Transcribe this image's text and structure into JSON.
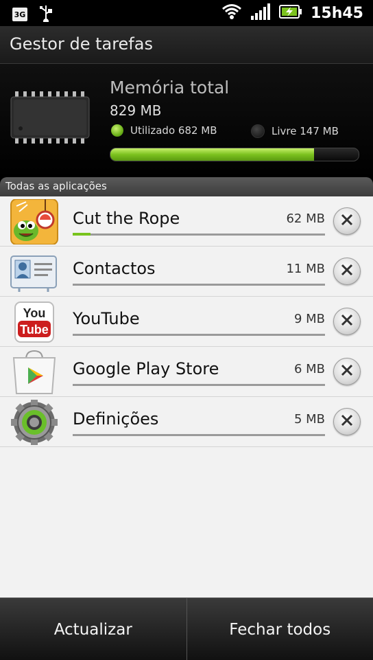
{
  "status_bar": {
    "network_badge": "3G",
    "usb_icon": "usb-icon",
    "wifi_icon": "wifi-icon",
    "signal_icon": "signal-icon",
    "battery_icon": "battery-charging-icon",
    "time": "15h45"
  },
  "header": {
    "title": "Gestor de tarefas"
  },
  "memory": {
    "title": "Memória total",
    "total": "829 MB",
    "used_label": "Utilizado 682 MB",
    "free_label": "Livre 147 MB",
    "used_fraction": 0.82,
    "colors": {
      "used": "#7cc21f",
      "free": "#1a1a1a"
    }
  },
  "section": {
    "title": "Todas as aplicações"
  },
  "apps": [
    {
      "name": "Cut the Rope",
      "size": "62 MB",
      "icon": "cut-the-rope-icon",
      "usage_fraction": 0.07
    },
    {
      "name": "Contactos",
      "size": "11 MB",
      "icon": "contacts-icon",
      "usage_fraction": 0.0
    },
    {
      "name": "YouTube",
      "size": "9 MB",
      "icon": "youtube-icon",
      "usage_fraction": 0.0
    },
    {
      "name": "Google Play Store",
      "size": "6 MB",
      "icon": "play-store-icon",
      "usage_fraction": 0.0
    },
    {
      "name": "Definições",
      "size": "5 MB",
      "icon": "settings-icon",
      "usage_fraction": 0.0
    }
  ],
  "bottom_bar": {
    "refresh_label": "Actualizar",
    "close_all_label": "Fechar todos"
  }
}
